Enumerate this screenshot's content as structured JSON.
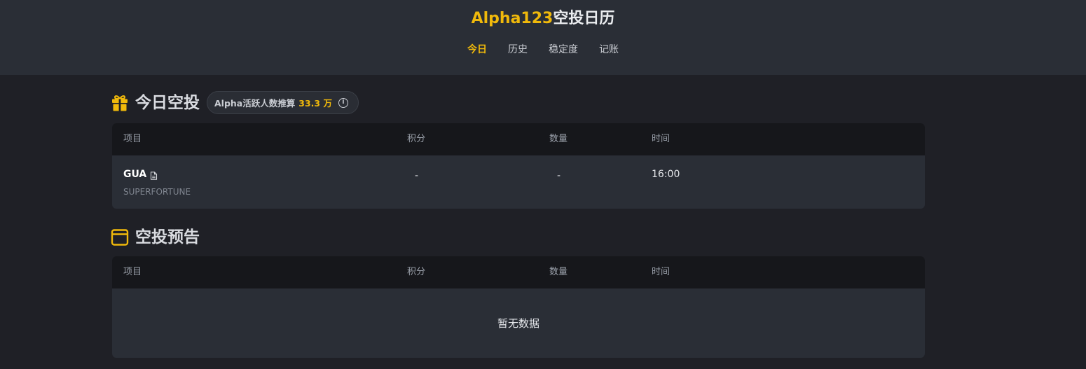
{
  "header": {
    "title_brand": "Alpha123",
    "title_rest": "空投日历",
    "nav": [
      {
        "label": "今日",
        "active": true
      },
      {
        "label": "历史",
        "active": false
      },
      {
        "label": "稳定度",
        "active": false
      },
      {
        "label": "记账",
        "active": false
      }
    ]
  },
  "today": {
    "title": "今日空投",
    "icon": "gift-icon",
    "active_users": {
      "label": "Alpha活跃人数推算",
      "value": "33.3 万",
      "icon": "info-icon"
    },
    "columns": [
      "项目",
      "积分",
      "数量",
      "时间"
    ],
    "rows": [
      {
        "name": "GUA",
        "subtitle": "SUPERFORTUNE",
        "points": "-",
        "amount": "-",
        "time": "16:00"
      }
    ]
  },
  "upcoming": {
    "title": "空投预告",
    "icon": "calendar-icon",
    "columns": [
      "项目",
      "积分",
      "数量",
      "时间"
    ],
    "empty_text": "暂无数据"
  },
  "colors": {
    "accent": "#f0b90b",
    "background": "#1f2026",
    "header_bg": "#2a2e36",
    "table_head_bg": "#16171b"
  }
}
